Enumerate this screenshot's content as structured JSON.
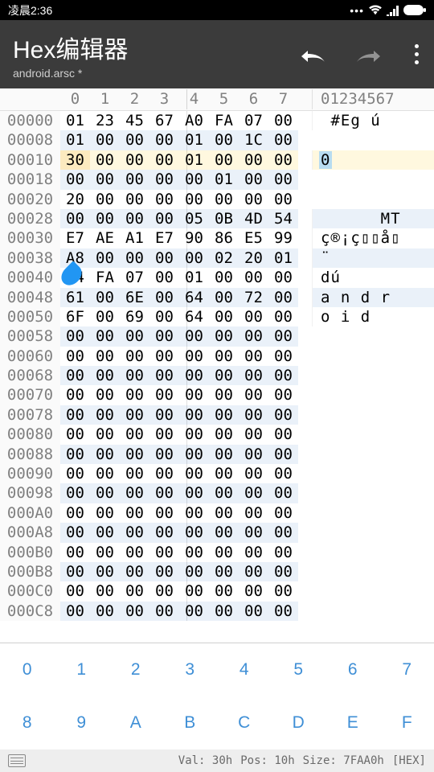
{
  "statusbar": {
    "time": "凌晨2:36"
  },
  "toolbar": {
    "title": "Hex编辑器",
    "subtitle": "android.arsc *"
  },
  "hex": {
    "col_headers": [
      "0",
      "1",
      "2",
      "3",
      "4",
      "5",
      "6",
      "7"
    ],
    "text_header": "01234567",
    "cursor_offset_row": 2,
    "cursor_byte_col": 0,
    "rows": [
      {
        "o": "00000",
        "b": [
          "01",
          "23",
          "45",
          "67",
          "A0",
          "FA",
          "07",
          "00"
        ],
        "t": " #Eg ú"
      },
      {
        "o": "00008",
        "b": [
          "01",
          "00",
          "00",
          "00",
          "01",
          "00",
          "1C",
          "00"
        ],
        "t": ""
      },
      {
        "o": "00010",
        "b": [
          "30",
          "00",
          "00",
          "00",
          "01",
          "00",
          "00",
          "00"
        ],
        "t": "0",
        "sel": true
      },
      {
        "o": "00018",
        "b": [
          "00",
          "00",
          "00",
          "00",
          "00",
          "01",
          "00",
          "00"
        ],
        "t": ""
      },
      {
        "o": "00020",
        "b": [
          "20",
          "00",
          "00",
          "00",
          "00",
          "00",
          "00",
          "00"
        ],
        "t": ""
      },
      {
        "o": "00028",
        "b": [
          "00",
          "00",
          "00",
          "00",
          "05",
          "0B",
          "4D",
          "54"
        ],
        "t": "      MT"
      },
      {
        "o": "00030",
        "b": [
          "E7",
          "AE",
          "A1",
          "E7",
          "90",
          "86",
          "E5",
          "99"
        ],
        "t": "ç®¡ç▯▯å▯"
      },
      {
        "o": "00038",
        "b": [
          "A8",
          "00",
          "00",
          "00",
          "00",
          "02",
          "20",
          "01"
        ],
        "t": "¨"
      },
      {
        "o": "00040",
        "b": [
          "64",
          "FA",
          "07",
          "00",
          "01",
          "00",
          "00",
          "00"
        ],
        "t": "dú"
      },
      {
        "o": "00048",
        "b": [
          "61",
          "00",
          "6E",
          "00",
          "64",
          "00",
          "72",
          "00"
        ],
        "t": "a n d r"
      },
      {
        "o": "00050",
        "b": [
          "6F",
          "00",
          "69",
          "00",
          "64",
          "00",
          "00",
          "00"
        ],
        "t": "o i d"
      },
      {
        "o": "00058",
        "b": [
          "00",
          "00",
          "00",
          "00",
          "00",
          "00",
          "00",
          "00"
        ],
        "t": ""
      },
      {
        "o": "00060",
        "b": [
          "00",
          "00",
          "00",
          "00",
          "00",
          "00",
          "00",
          "00"
        ],
        "t": ""
      },
      {
        "o": "00068",
        "b": [
          "00",
          "00",
          "00",
          "00",
          "00",
          "00",
          "00",
          "00"
        ],
        "t": ""
      },
      {
        "o": "00070",
        "b": [
          "00",
          "00",
          "00",
          "00",
          "00",
          "00",
          "00",
          "00"
        ],
        "t": ""
      },
      {
        "o": "00078",
        "b": [
          "00",
          "00",
          "00",
          "00",
          "00",
          "00",
          "00",
          "00"
        ],
        "t": ""
      },
      {
        "o": "00080",
        "b": [
          "00",
          "00",
          "00",
          "00",
          "00",
          "00",
          "00",
          "00"
        ],
        "t": ""
      },
      {
        "o": "00088",
        "b": [
          "00",
          "00",
          "00",
          "00",
          "00",
          "00",
          "00",
          "00"
        ],
        "t": ""
      },
      {
        "o": "00090",
        "b": [
          "00",
          "00",
          "00",
          "00",
          "00",
          "00",
          "00",
          "00"
        ],
        "t": ""
      },
      {
        "o": "00098",
        "b": [
          "00",
          "00",
          "00",
          "00",
          "00",
          "00",
          "00",
          "00"
        ],
        "t": ""
      },
      {
        "o": "000A0",
        "b": [
          "00",
          "00",
          "00",
          "00",
          "00",
          "00",
          "00",
          "00"
        ],
        "t": ""
      },
      {
        "o": "000A8",
        "b": [
          "00",
          "00",
          "00",
          "00",
          "00",
          "00",
          "00",
          "00"
        ],
        "t": ""
      },
      {
        "o": "000B0",
        "b": [
          "00",
          "00",
          "00",
          "00",
          "00",
          "00",
          "00",
          "00"
        ],
        "t": ""
      },
      {
        "o": "000B8",
        "b": [
          "00",
          "00",
          "00",
          "00",
          "00",
          "00",
          "00",
          "00"
        ],
        "t": ""
      },
      {
        "o": "000C0",
        "b": [
          "00",
          "00",
          "00",
          "00",
          "00",
          "00",
          "00",
          "00"
        ],
        "t": ""
      },
      {
        "o": "000C8",
        "b": [
          "00",
          "00",
          "00",
          "00",
          "00",
          "00",
          "00",
          "00"
        ],
        "t": ""
      }
    ]
  },
  "keypad": [
    "0",
    "1",
    "2",
    "3",
    "4",
    "5",
    "6",
    "7",
    "8",
    "9",
    "A",
    "B",
    "C",
    "D",
    "E",
    "F"
  ],
  "footer": {
    "val_label": "Val:",
    "val": "30h",
    "pos_label": "Pos:",
    "pos": "10h",
    "size_label": "Size:",
    "size": "7FAA0h",
    "mode": "[HEX]"
  }
}
